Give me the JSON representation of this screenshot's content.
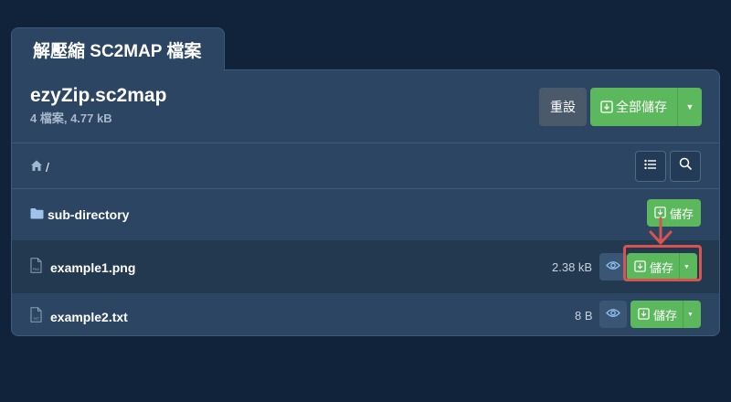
{
  "tab": {
    "title": "解壓縮 SC2MAP 檔案"
  },
  "archive": {
    "name": "ezyZip.sc2map",
    "meta": "4 檔案, 4.77 kB"
  },
  "header_buttons": {
    "reset_label": "重設",
    "save_all_label": "全部儲存"
  },
  "breadcrumb": {
    "separator": "/"
  },
  "toolbar": {
    "icons": [
      "list-view-icon",
      "search-icon"
    ]
  },
  "files": [
    {
      "name": "sub-directory",
      "type": "folder",
      "size": "",
      "save_label": "儲存"
    },
    {
      "name": "example1.png",
      "type": "png",
      "size": "2.38 kB",
      "save_label": "儲存"
    },
    {
      "name": "example2.txt",
      "type": "txt",
      "size": "8 B",
      "save_label": "儲存"
    }
  ],
  "colors": {
    "background": "#11233a",
    "panel": "#2b4563",
    "accent_green": "#5cb85c",
    "highlight_red": "#d9534f"
  }
}
